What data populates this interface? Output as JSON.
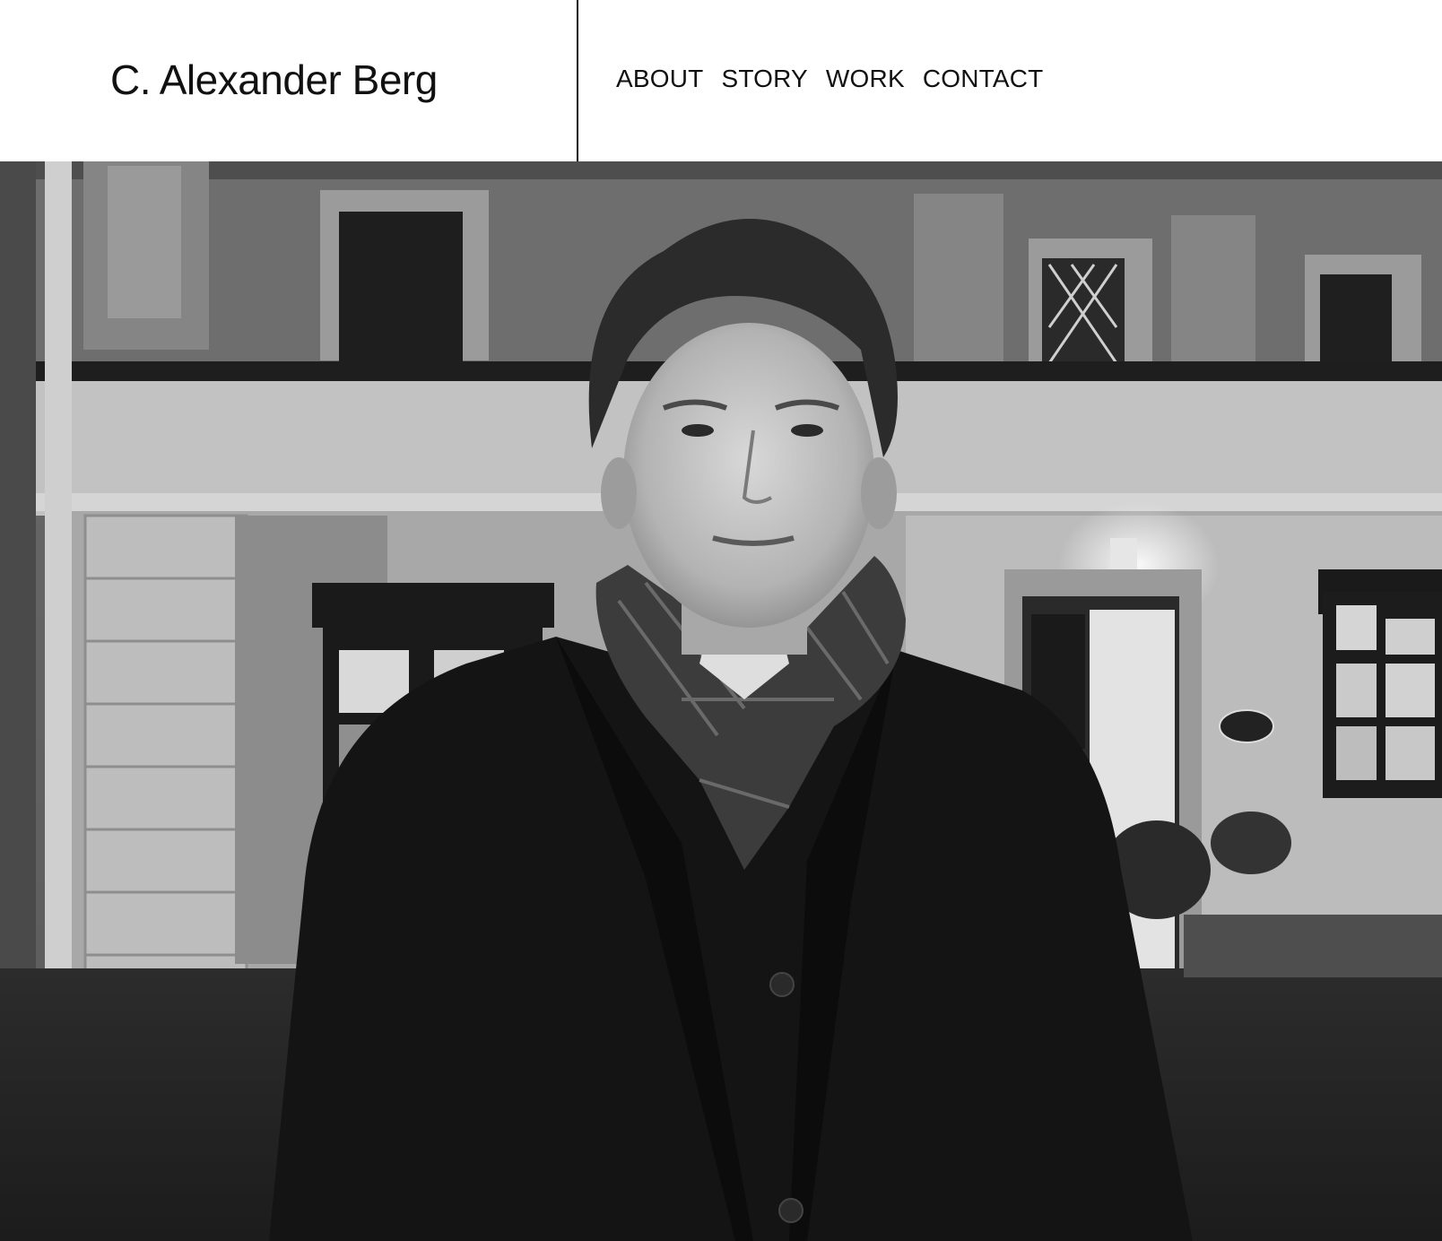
{
  "site": {
    "title": "C. Alexander Berg"
  },
  "nav": {
    "items": [
      {
        "label": "ABOUT"
      },
      {
        "label": "STORY"
      },
      {
        "label": "WORK"
      },
      {
        "label": "CONTACT"
      }
    ]
  },
  "hero": {
    "kind": "photograph",
    "colors": {
      "header_bg": "#ffffff",
      "text": "#111111"
    }
  }
}
